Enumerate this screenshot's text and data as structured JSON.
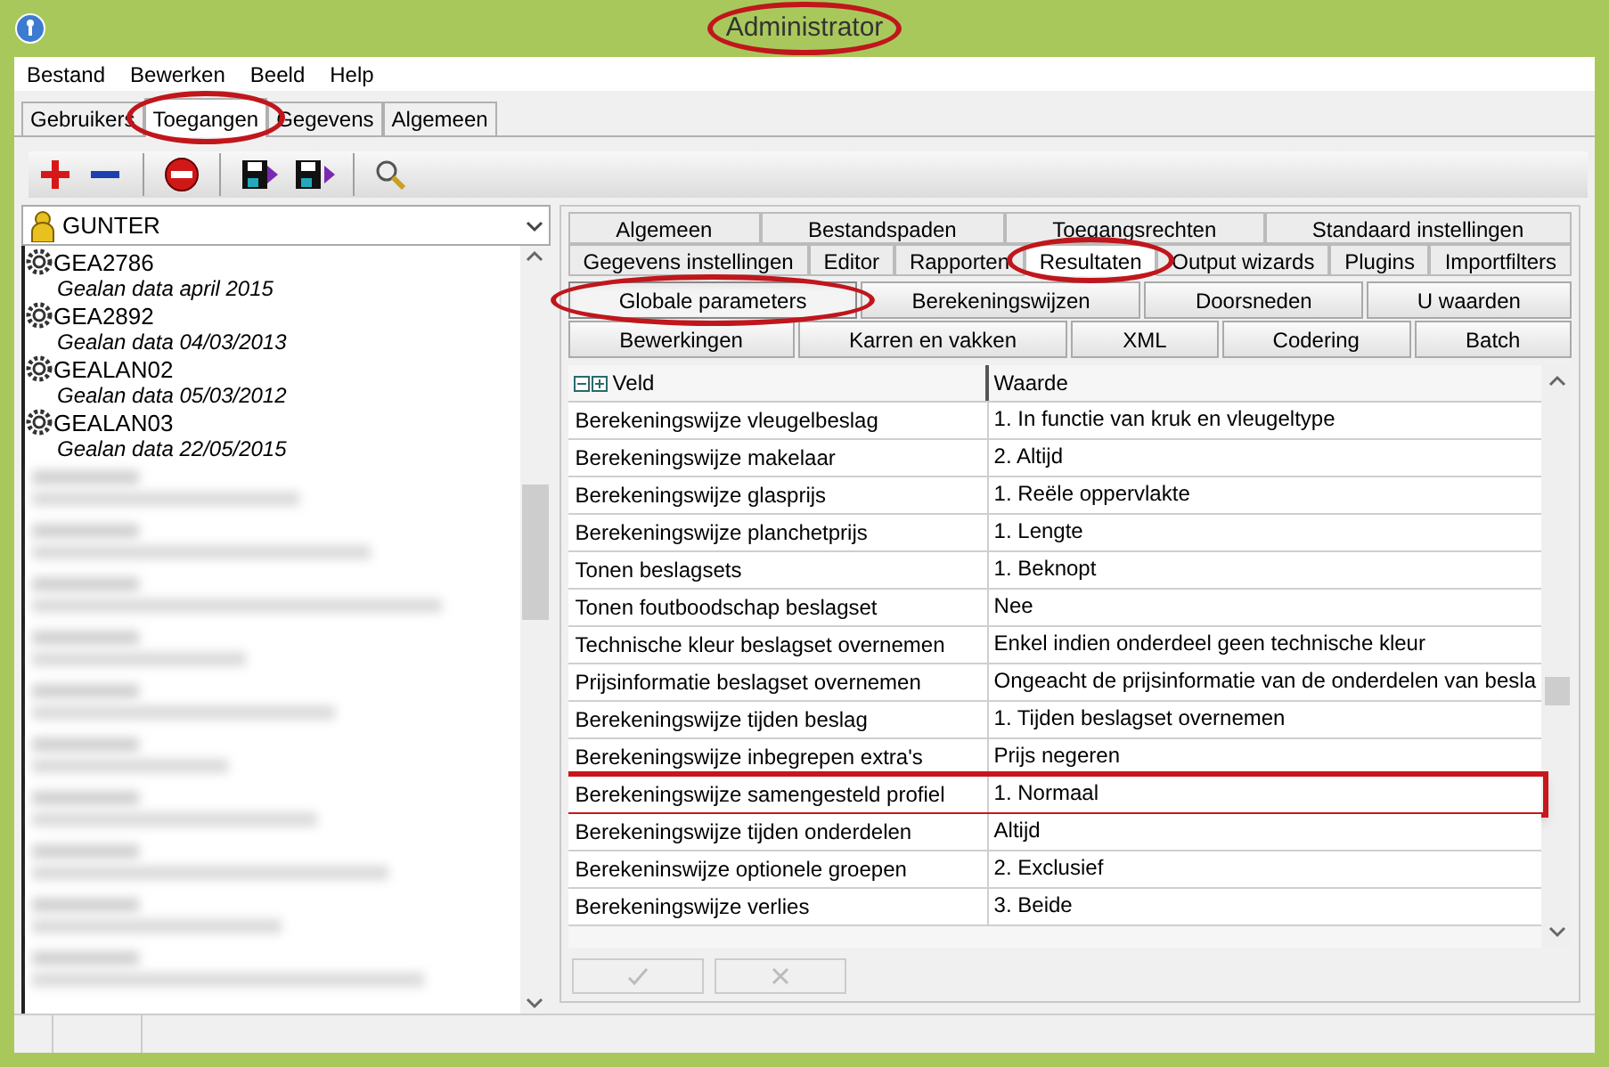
{
  "window": {
    "title": "Administrator",
    "circled": true
  },
  "menu": [
    "Bestand",
    "Bewerken",
    "Beeld",
    "Help"
  ],
  "main_tabs": [
    {
      "label": "Gebruikers",
      "selected": false,
      "circled": false
    },
    {
      "label": "Toegangen",
      "selected": true,
      "circled": true
    },
    {
      "label": "Gegevens",
      "selected": false,
      "circled": false
    },
    {
      "label": "Algemeen",
      "selected": false,
      "circled": false
    }
  ],
  "toolbar": [
    {
      "kind": "add"
    },
    {
      "kind": "remove"
    },
    {
      "kind": "sep"
    },
    {
      "kind": "stop"
    },
    {
      "kind": "sep"
    },
    {
      "kind": "import"
    },
    {
      "kind": "export"
    },
    {
      "kind": "sep"
    },
    {
      "kind": "search"
    }
  ],
  "user_select": {
    "value": "GUNTER"
  },
  "access_list": [
    {
      "name": "GEA2786",
      "description": "Gealan data april 2015"
    },
    {
      "name": "GEA2892",
      "description": "Gealan data 04/03/2013"
    },
    {
      "name": "GEALAN02",
      "description": "Gealan data 05/03/2012"
    },
    {
      "name": "GEALAN03",
      "description": "Gealan data 22/05/2015"
    },
    {
      "kind": "blurred"
    },
    {
      "kind": "blurred"
    },
    {
      "kind": "blurred"
    },
    {
      "kind": "blurred"
    },
    {
      "kind": "blurred"
    },
    {
      "kind": "blurred"
    },
    {
      "kind": "blurred"
    },
    {
      "kind": "blurred"
    },
    {
      "kind": "blurred"
    },
    {
      "kind": "blurred"
    }
  ],
  "settings_tabs": [
    [
      {
        "label": "Algemeen",
        "selected": false,
        "circled": false
      },
      {
        "label": "Bestandspaden",
        "selected": false,
        "circled": false
      },
      {
        "label": "Toegangsrechten",
        "selected": false,
        "circled": false
      },
      {
        "label": "Standaard instellingen",
        "selected": false,
        "circled": false
      }
    ],
    [
      {
        "label": "Gegevens instellingen",
        "selected": false,
        "circled": false
      },
      {
        "label": "Editor",
        "selected": false,
        "circled": false
      },
      {
        "label": "Rapporten",
        "selected": false,
        "circled": false
      },
      {
        "label": "Resultaten",
        "selected": true,
        "circled": true
      },
      {
        "label": "Output wizards",
        "selected": false,
        "circled": false
      },
      {
        "label": "Plugins",
        "selected": false,
        "circled": false
      },
      {
        "label": "Importfilters",
        "selected": false,
        "circled": false
      }
    ]
  ],
  "sub_buttons": [
    [
      {
        "label": "Globale parameters",
        "selected": true,
        "circled": true
      },
      {
        "label": "Berekeningswijzen",
        "selected": false,
        "circled": false
      },
      {
        "label": "Doorsneden",
        "selected": false,
        "circled": false
      },
      {
        "label": "U waarden",
        "selected": false,
        "circled": false
      }
    ],
    [
      {
        "label": "Bewerkingen",
        "selected": false,
        "circled": false
      },
      {
        "label": "Karren en vakken",
        "selected": false,
        "circled": false
      },
      {
        "label": "XML",
        "selected": false,
        "circled": false
      },
      {
        "label": "Codering",
        "selected": false,
        "circled": false
      },
      {
        "label": "Batch",
        "selected": false,
        "circled": false
      }
    ]
  ],
  "table": {
    "columns": [
      "Veld",
      "Waarde"
    ],
    "rows": [
      {
        "field": "Berekeningswijze vleugelbeslag",
        "value": "1. In functie van kruk en vleugeltype",
        "boxed": false
      },
      {
        "field": "Berekeningswijze makelaar",
        "value": "2. Altijd",
        "boxed": false
      },
      {
        "field": "Berekeningswijze glasprijs",
        "value": "1. Reële oppervlakte",
        "boxed": false
      },
      {
        "field": "Berekeningswijze planchetprijs",
        "value": "1. Lengte",
        "boxed": false
      },
      {
        "field": "Tonen beslagsets",
        "value": "1. Beknopt",
        "boxed": false
      },
      {
        "field": "Tonen foutboodschap beslagset",
        "value": "Nee",
        "boxed": false
      },
      {
        "field": "Technische kleur beslagset overnemen",
        "value": "Enkel indien onderdeel geen technische kleur",
        "boxed": false
      },
      {
        "field": "Prijsinformatie beslagset overnemen",
        "value": "Ongeacht de prijsinformatie van de onderdelen van besla",
        "boxed": false
      },
      {
        "field": "Berekeningswijze tijden beslag",
        "value": "1. Tijden beslagset overnemen",
        "boxed": false
      },
      {
        "field": "Berekeningswijze inbegrepen extra's",
        "value": "Prijs negeren",
        "boxed": false
      },
      {
        "field": "Berekeningswijze samengesteld profiel",
        "value": "1. Normaal",
        "boxed": true
      },
      {
        "field": "Berekeningswijze tijden onderdelen",
        "value": "Altijd",
        "boxed": false
      },
      {
        "field": "Berekeninswijze optionele groepen",
        "value": "2. Exclusief",
        "boxed": false
      },
      {
        "field": "Berekeningswijze verlies",
        "value": "3. Beide",
        "boxed": false
      }
    ]
  },
  "actions": [
    {
      "kind": "confirm",
      "disabled": true
    },
    {
      "kind": "cancel",
      "disabled": true
    }
  ]
}
